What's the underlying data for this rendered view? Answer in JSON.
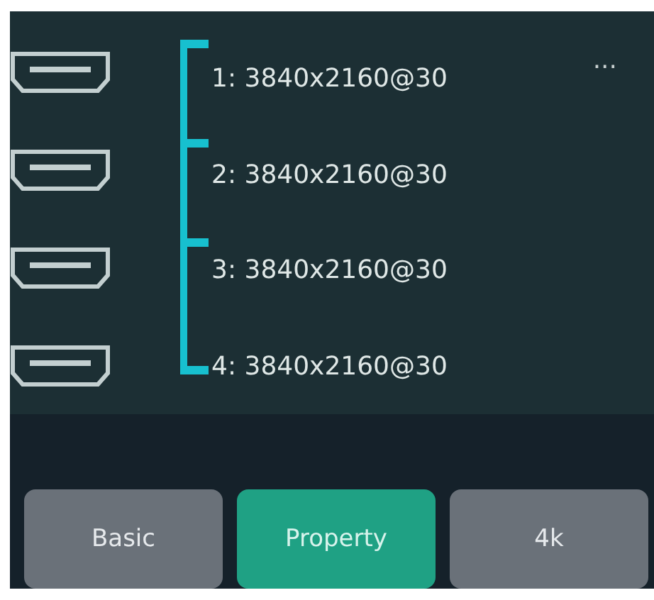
{
  "outputs": [
    {
      "label": "1: 3840x2160@30"
    },
    {
      "label": "2: 3840x2160@30"
    },
    {
      "label": "3: 3840x2160@30"
    },
    {
      "label": "4: 3840x2160@30"
    }
  ],
  "more": "...",
  "tabs": [
    {
      "label": "Basic",
      "selected": false
    },
    {
      "label": "Property",
      "selected": true
    },
    {
      "label": "4k",
      "selected": false
    }
  ]
}
